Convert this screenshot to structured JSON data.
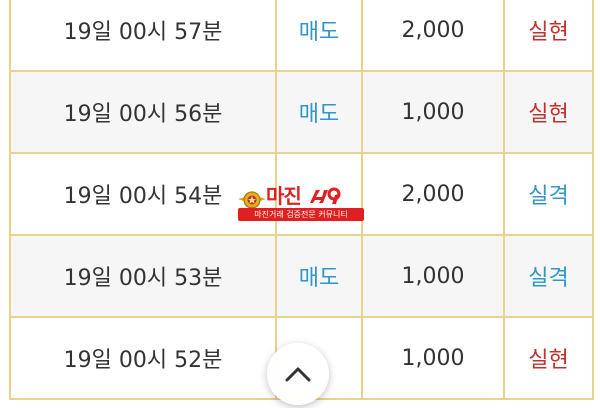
{
  "rows": [
    {
      "time": "19일 00시 57분",
      "type": "매도",
      "amount": "2,000",
      "result": "실현",
      "result_kind": "win"
    },
    {
      "time": "19일 00시 56분",
      "type": "매도",
      "amount": "1,000",
      "result": "실현",
      "result_kind": "win"
    },
    {
      "time": "19일 00시 54분",
      "type": "",
      "amount": "2,000",
      "result": "실격",
      "result_kind": "lose"
    },
    {
      "time": "19일 00시 53분",
      "type": "매도",
      "amount": "1,000",
      "result": "실격",
      "result_kind": "lose"
    },
    {
      "time": "19일 00시 52분",
      "type": "",
      "amount": "1,000",
      "result": "실현",
      "result_kind": "win"
    }
  ],
  "watermark": {
    "title": "마진 ",
    "tagline": "마진거래 검증전문 커뮤니티"
  },
  "colors": {
    "border": "#e9d28c",
    "type_text": "#2f97c7",
    "win_text": "#c0312b",
    "lose_text": "#2f97c7",
    "watermark_red": "#e02020"
  },
  "icons": {
    "top_button": "chevron-up-icon",
    "emblem": "police-emblem-icon"
  }
}
